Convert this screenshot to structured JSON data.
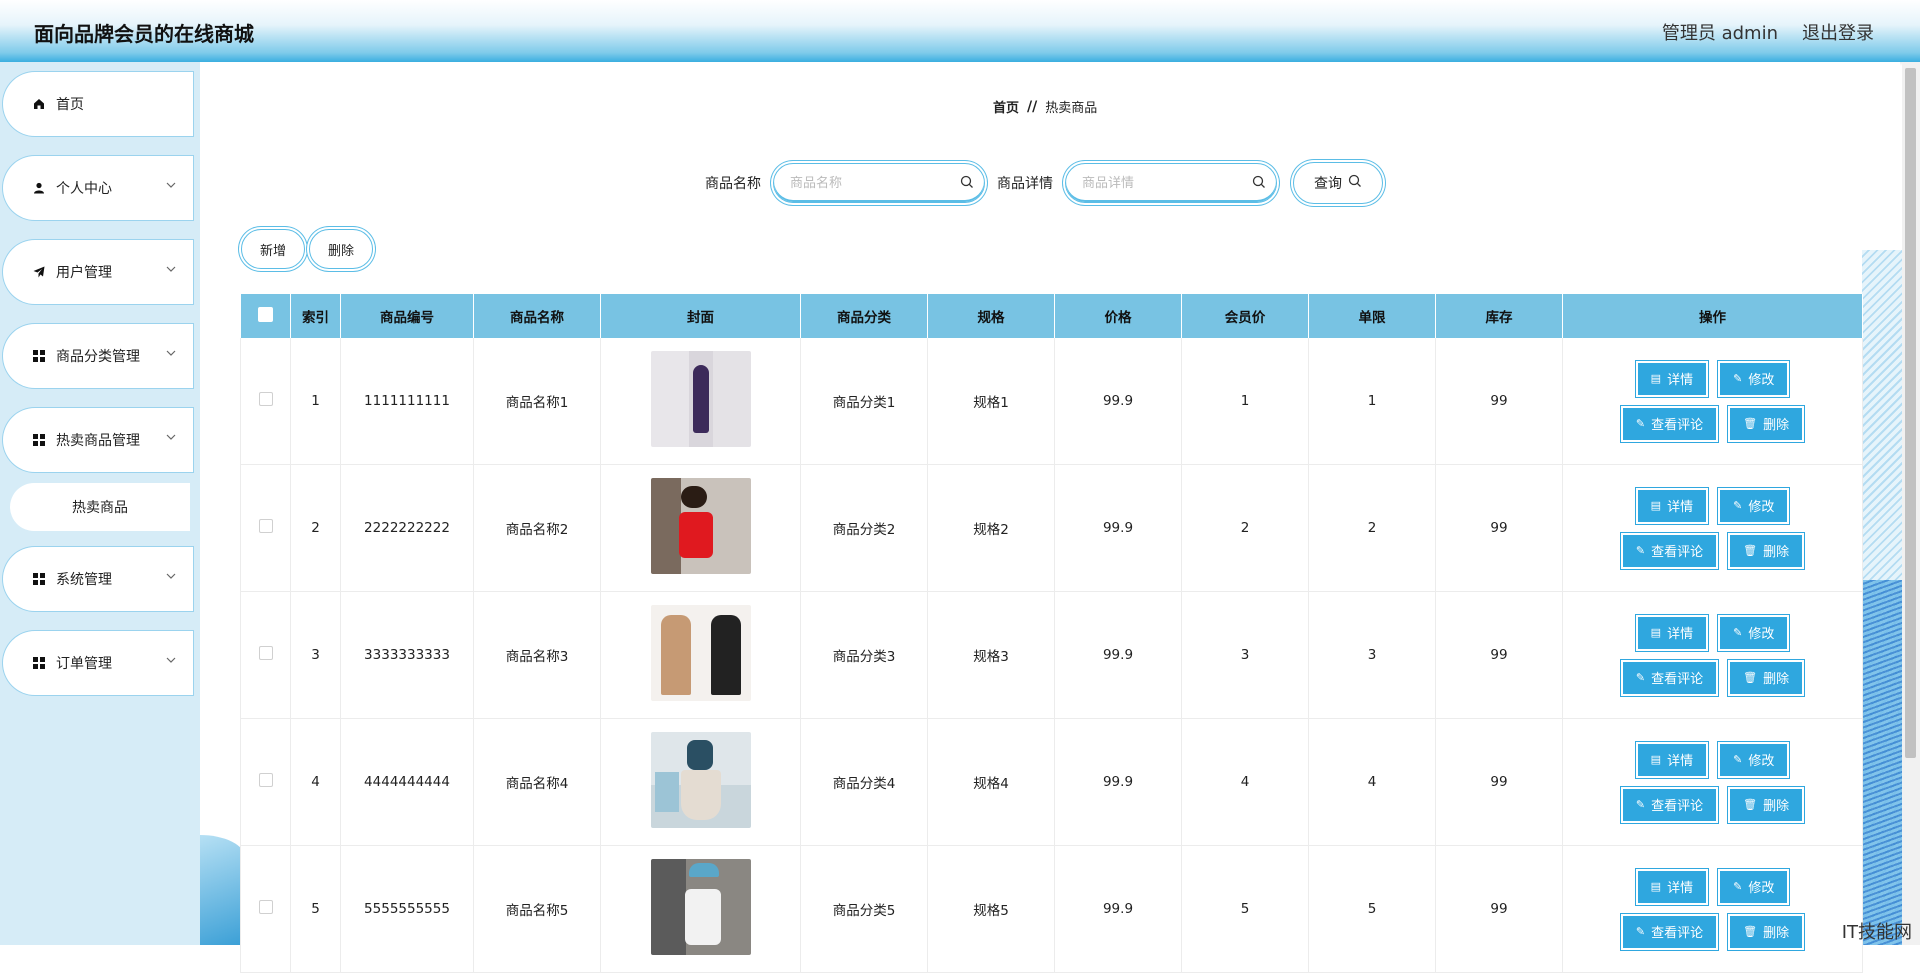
{
  "app": {
    "title": "面向品牌会员的在线商城"
  },
  "header": {
    "user": "管理员 admin",
    "logout": "退出登录"
  },
  "sidebar": {
    "items": [
      {
        "label": "首页",
        "icon": "home-icon"
      },
      {
        "label": "个人中心",
        "icon": "user-icon"
      },
      {
        "label": "用户管理",
        "icon": "paper-plane-icon"
      },
      {
        "label": "商品分类管理",
        "icon": "grid-icon"
      },
      {
        "label": "热卖商品管理",
        "icon": "grid-icon"
      },
      {
        "label": "系统管理",
        "icon": "grid-icon"
      },
      {
        "label": "订单管理",
        "icon": "grid-icon"
      }
    ],
    "sub_item": "热卖商品"
  },
  "breadcrumb": {
    "home": "首页",
    "sep": "//",
    "current": "热卖商品"
  },
  "search": {
    "name_label": "商品名称",
    "name_placeholder": "商品名称",
    "detail_label": "商品详情",
    "detail_placeholder": "商品详情",
    "query": "查询"
  },
  "actions": {
    "add": "新增",
    "delete": "删除"
  },
  "table": {
    "headers": [
      "索引",
      "商品编号",
      "商品名称",
      "封面",
      "商品分类",
      "规格",
      "价格",
      "会员价",
      "单限",
      "库存",
      "操作"
    ],
    "rows": [
      {
        "index": "1",
        "code": "1111111111",
        "name": "商品名称1",
        "category": "商品分类1",
        "spec": "规格1",
        "price": "99.9",
        "member_price": "1",
        "limit": "1",
        "stock": "99"
      },
      {
        "index": "2",
        "code": "2222222222",
        "name": "商品名称2",
        "category": "商品分类2",
        "spec": "规格2",
        "price": "99.9",
        "member_price": "2",
        "limit": "2",
        "stock": "99"
      },
      {
        "index": "3",
        "code": "3333333333",
        "name": "商品名称3",
        "category": "商品分类3",
        "spec": "规格3",
        "price": "99.9",
        "member_price": "3",
        "limit": "3",
        "stock": "99"
      },
      {
        "index": "4",
        "code": "4444444444",
        "name": "商品名称4",
        "category": "商品分类4",
        "spec": "规格4",
        "price": "99.9",
        "member_price": "4",
        "limit": "4",
        "stock": "99"
      },
      {
        "index": "5",
        "code": "5555555555",
        "name": "商品名称5",
        "category": "商品分类5",
        "spec": "规格5",
        "price": "99.9",
        "member_price": "5",
        "limit": "5",
        "stock": "99"
      }
    ],
    "ops": {
      "detail": "详情",
      "edit": "修改",
      "comments": "查看评论",
      "delete": "删除"
    }
  },
  "watermark": "IT技能网",
  "colors": {
    "accent": "#2fa7df",
    "header_bg": "#78c3e3",
    "sidebar_bg": "#d6ecf7"
  }
}
